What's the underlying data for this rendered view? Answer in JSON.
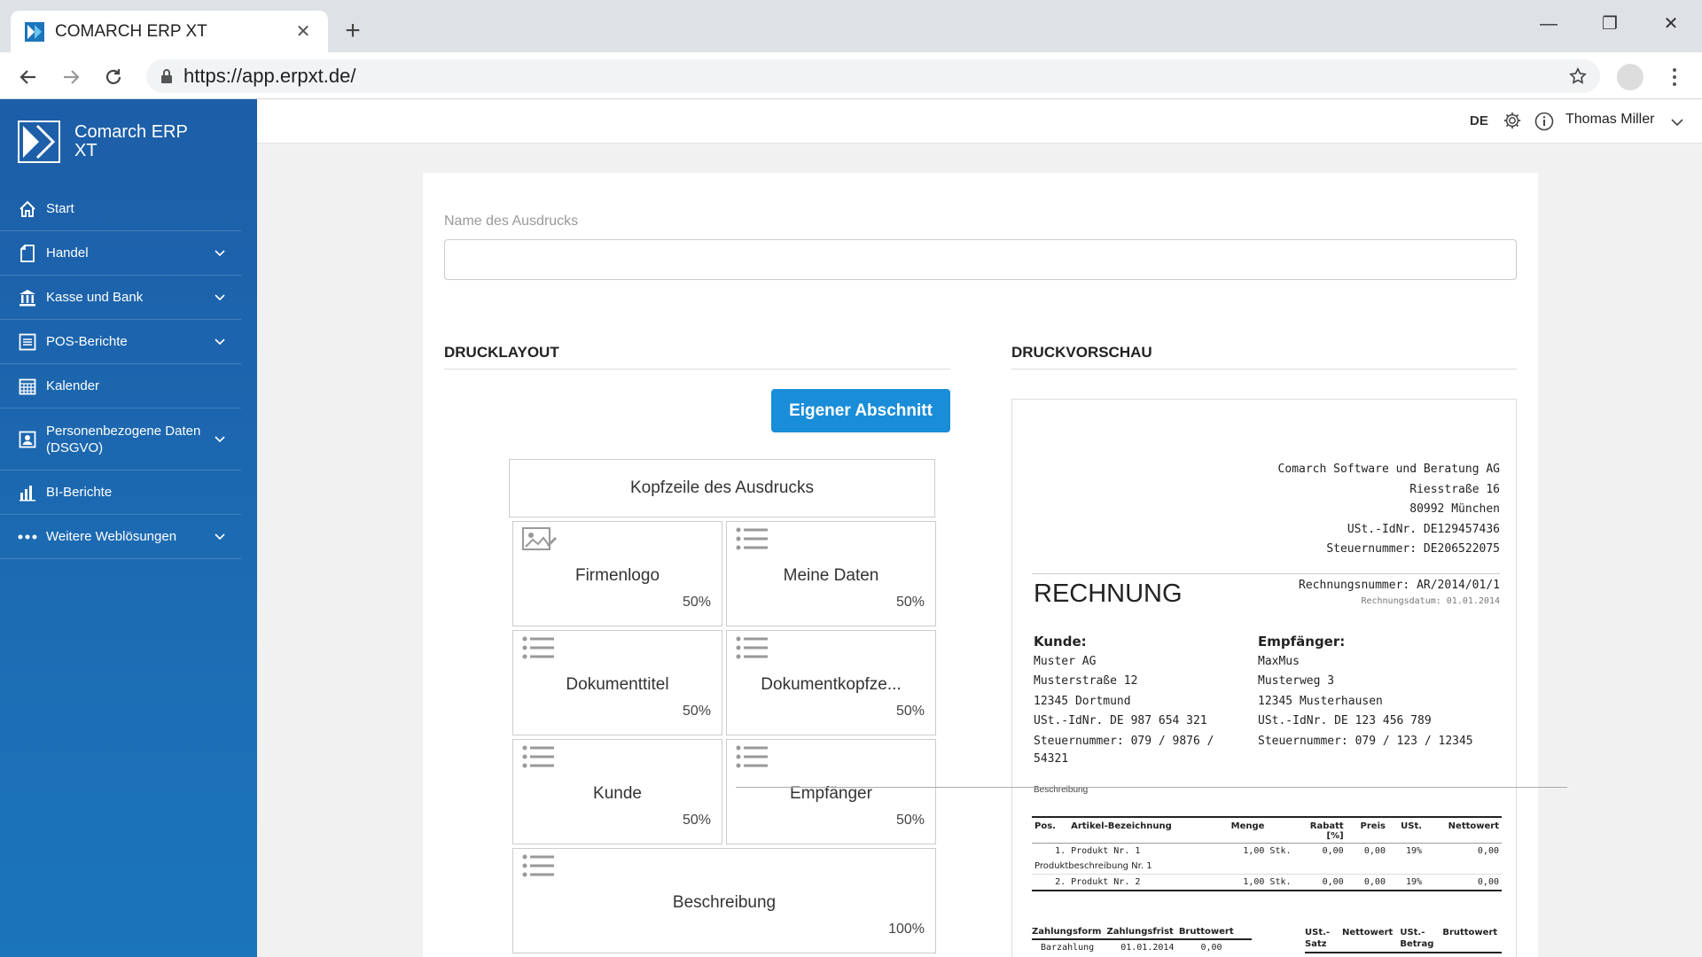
{
  "browser": {
    "tab_title": "COMARCH ERP XT",
    "tab_close": "✕",
    "new_tab": "+",
    "url": "https://app.erpxt.de/",
    "win_min": "—",
    "win_restore": "❐",
    "win_close": "✕"
  },
  "sidebar": {
    "brand": "Comarch ERP XT",
    "items": [
      {
        "label": "Start",
        "icon": "home-icon",
        "has_chevron": false
      },
      {
        "label": "Handel",
        "icon": "document-icon",
        "has_chevron": true
      },
      {
        "label": "Kasse und Bank",
        "icon": "bank-icon",
        "has_chevron": true
      },
      {
        "label": "POS-Berichte",
        "icon": "report-icon",
        "has_chevron": true
      },
      {
        "label": "Kalender",
        "icon": "calendar-icon",
        "has_chevron": false
      },
      {
        "label": "Personenbezogene Daten (DSGVO)",
        "icon": "person-card-icon",
        "has_chevron": true
      },
      {
        "label": "BI-Berichte",
        "icon": "bar-chart-icon",
        "has_chevron": false
      },
      {
        "label": "Weitere Weblösungen",
        "icon": "more-dots-icon",
        "has_chevron": true
      }
    ]
  },
  "header": {
    "language": "DE",
    "user_name": "Thomas Miller"
  },
  "form": {
    "name_label": "Name des Ausdrucks",
    "name_value": "",
    "layout_title": "DRUCKLAYOUT",
    "preview_title": "DRUCKVORSCHAU",
    "own_section_button": "Eigener Abschnitt",
    "header_block": "Kopfzeile des Ausdrucks",
    "tiles": [
      {
        "name": "Firmenlogo",
        "pct": "50%",
        "icon": "image-icon"
      },
      {
        "name": "Meine Daten",
        "pct": "50%",
        "icon": "list-icon"
      },
      {
        "name": "Dokumenttitel",
        "pct": "50%",
        "icon": "list-icon"
      },
      {
        "name": "Dokumentkopfze...",
        "pct": "50%",
        "icon": "list-icon"
      },
      {
        "name": "Kunde",
        "pct": "50%",
        "icon": "list-icon"
      },
      {
        "name": "Empfänger",
        "pct": "50%",
        "icon": "list-icon"
      },
      {
        "name": "Beschreibung",
        "pct": "100%",
        "icon": "list-icon"
      }
    ]
  },
  "preview": {
    "company": [
      "Comarch Software und Beratung AG",
      "Riesstraße 16",
      "80992 München",
      "USt.-IdNr. DE129457436",
      "Steuernummer: DE206522075"
    ],
    "doc_title": "RECHNUNG",
    "invoice_no": "Rechnungsnummer: AR/2014/01/1",
    "invoice_date": "Rechnungsdatum: 01.01.2014",
    "customer": {
      "heading": "Kunde:",
      "lines": [
        "Muster AG",
        "Musterstraße 12",
        "12345 Dortmund",
        "USt.-IdNr. DE 987 654 321",
        "Steuernummer: 079 / 9876 /",
        "54321"
      ]
    },
    "recipient": {
      "heading": "Empfänger:",
      "lines": [
        "MaxMus",
        "Musterweg 3",
        "12345 Musterhausen",
        "USt.-IdNr. DE 123 456 789",
        "Steuernummer: 079 / 123 / 12345"
      ]
    },
    "description_label": "Beschreibung",
    "table_headers": [
      "Pos.",
      "Artikel-Bezeichnung",
      "Menge",
      "",
      "Rabatt [%]",
      "Preis",
      "USt.",
      "Nettowert"
    ],
    "rows": [
      {
        "pos": "1.",
        "name": "Produkt Nr. 1",
        "qty": "1,00",
        "unit": "Stk.",
        "discount": "0,00",
        "price": "0,00",
        "vat": "19%",
        "net": "0,00",
        "desc": "Produktbeschreibung Nr. 1"
      },
      {
        "pos": "2.",
        "name": "Produkt Nr. 2",
        "qty": "1,00",
        "unit": "Stk.",
        "discount": "0,00",
        "price": "0,00",
        "vat": "19%",
        "net": "0,00"
      }
    ],
    "pay_headers": [
      "Zahlungsform",
      "Zahlungsfrist",
      "Bruttowert"
    ],
    "pay_row": [
      "Barzahlung",
      "01.01.2014",
      "0,00"
    ],
    "vat_headers": [
      "USt.- Satz",
      "Nettowert",
      "USt.- Betrag",
      "Bruttowert"
    ]
  },
  "colors": {
    "sidebar": "#1d5ea8",
    "button": "#1a8dd8"
  }
}
